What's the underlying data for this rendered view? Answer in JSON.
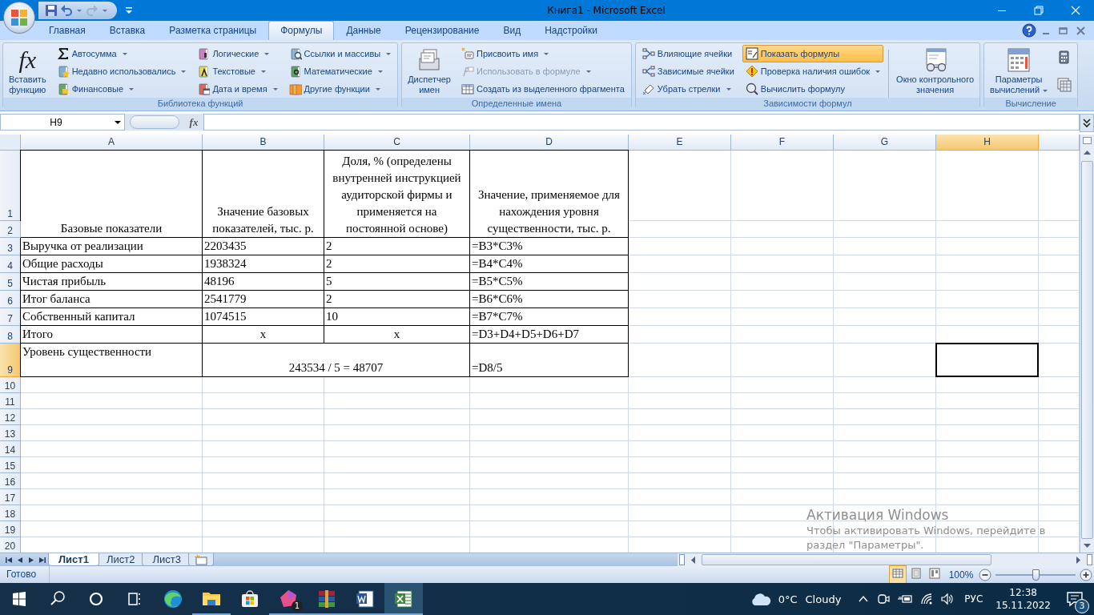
{
  "title_bar": {
    "title": "Книга1 - Microsoft Excel"
  },
  "ribbon": {
    "tabs": [
      {
        "label": "Главная",
        "selected": false
      },
      {
        "label": "Вставка",
        "selected": false
      },
      {
        "label": "Разметка страницы",
        "selected": false
      },
      {
        "label": "Формулы",
        "selected": true
      },
      {
        "label": "Данные",
        "selected": false
      },
      {
        "label": "Рецензирование",
        "selected": false
      },
      {
        "label": "Вид",
        "selected": false
      },
      {
        "label": "Надстройки",
        "selected": false
      }
    ],
    "groups": [
      {
        "label": "Библиотека функций",
        "controls": [
          {
            "kind": "large",
            "label": "Вставить\nфункцию",
            "glyph": "fx",
            "dropdown": false
          },
          {
            "kind": "column",
            "items": [
              {
                "label": "Автосумма",
                "dropdown": true,
                "disabled": false,
                "on": false
              },
              {
                "label": "Недавно использовались",
                "dropdown": true,
                "disabled": false,
                "on": false
              },
              {
                "label": "Финансовые",
                "dropdown": true,
                "disabled": false,
                "on": false
              }
            ]
          },
          {
            "kind": "column",
            "items": [
              {
                "label": "Логические",
                "dropdown": true,
                "disabled": false,
                "on": false
              },
              {
                "label": "Текстовые",
                "dropdown": true,
                "disabled": false,
                "on": false
              },
              {
                "label": "Дата и время",
                "dropdown": true,
                "disabled": false,
                "on": false
              }
            ]
          },
          {
            "kind": "column",
            "items": [
              {
                "label": "Ссылки и массивы",
                "dropdown": true,
                "disabled": false,
                "on": false
              },
              {
                "label": "Математические",
                "dropdown": true,
                "disabled": false,
                "on": false
              },
              {
                "label": "Другие функции",
                "dropdown": true,
                "disabled": false,
                "on": false
              }
            ]
          }
        ]
      },
      {
        "label": "Определенные имена",
        "controls": [
          {
            "kind": "large",
            "label": "Диспетчер\nимен",
            "dropdown": false
          },
          {
            "kind": "column",
            "items": [
              {
                "label": "Присвоить имя",
                "dropdown": true,
                "disabled": false,
                "on": false
              },
              {
                "label": "Использовать в формуле",
                "dropdown": true,
                "disabled": true,
                "on": false
              },
              {
                "label": "Создать из выделенного фрагмента",
                "dropdown": false,
                "disabled": false,
                "on": false
              }
            ]
          }
        ]
      },
      {
        "label": "Зависимости формул",
        "controls": [
          {
            "kind": "column",
            "items": [
              {
                "label": "Влияющие ячейки",
                "dropdown": false,
                "disabled": false,
                "on": false
              },
              {
                "label": "Зависимые ячейки",
                "dropdown": false,
                "disabled": false,
                "on": false
              },
              {
                "label": "Убрать стрелки",
                "dropdown": true,
                "disabled": false,
                "on": false
              }
            ]
          },
          {
            "kind": "column",
            "items": [
              {
                "label": "Показать формулы",
                "dropdown": false,
                "disabled": false,
                "on": true
              },
              {
                "label": "Проверка наличия ошибок",
                "dropdown": true,
                "disabled": false,
                "on": false
              },
              {
                "label": "Вычислить формулу",
                "dropdown": false,
                "disabled": false,
                "on": false
              }
            ]
          },
          {
            "kind": "separator"
          },
          {
            "kind": "large",
            "label": "Окно контрольного\nзначения",
            "dropdown": false
          }
        ]
      },
      {
        "label": "Вычисление",
        "controls": [
          {
            "kind": "large",
            "label": "Параметры\nвычислений",
            "dropdown": true
          },
          {
            "kind": "icons",
            "buttons": [
              {
                "on": false
              },
              {
                "on": false
              }
            ]
          }
        ]
      }
    ]
  },
  "formula_bar": {
    "name_box": "H9",
    "fx": "fx"
  },
  "sheet": {
    "columns": [
      {
        "label": "A",
        "selected": false
      },
      {
        "label": "B",
        "selected": false
      },
      {
        "label": "C",
        "selected": false
      },
      {
        "label": "D",
        "selected": false
      },
      {
        "label": "E",
        "selected": false
      },
      {
        "label": "F",
        "selected": false
      },
      {
        "label": "G",
        "selected": false
      },
      {
        "label": "H",
        "selected": true
      }
    ],
    "rows": [
      {
        "number": "1",
        "selected": false,
        "kind": "header",
        "cells": [
          "Базовые показатели",
          "Значение базовых показателей, тыс. р.",
          "Доля, % (определены внутренней инструкцией аудиторской фирмы и применяется на постоянной основе)",
          "Значение, применяемое для нахождения уровня существенности, тыс. р."
        ]
      },
      {
        "number": "2",
        "selected": false
      },
      {
        "number": "3",
        "selected": false,
        "kind": "data",
        "cells": [
          "Выручка от реализации",
          "2203435",
          "2",
          "=B3*C3%"
        ]
      },
      {
        "number": "4",
        "selected": false,
        "kind": "data",
        "cells": [
          "Общие расходы",
          "1938324",
          "2",
          "=B4*C4%"
        ]
      },
      {
        "number": "5",
        "selected": false,
        "kind": "data",
        "cells": [
          "Чистая прибыль",
          "48196",
          "5",
          "=B5*C5%"
        ]
      },
      {
        "number": "6",
        "selected": false,
        "kind": "data",
        "cells": [
          "Итог баланса",
          "2541779",
          "2",
          "=B6*C6%"
        ]
      },
      {
        "number": "7",
        "selected": false,
        "kind": "data",
        "cells": [
          "Собственный капитал",
          "1074515",
          "10",
          "=B7*C7%"
        ]
      },
      {
        "number": "8",
        "selected": false,
        "kind": "total",
        "cells": [
          "Итого",
          "x",
          "x",
          "=D3+D4+D5+D6+D7"
        ]
      },
      {
        "number": "9",
        "selected": true,
        "kind": "summary",
        "cells": [
          "Уровень существенности",
          "243534 / 5 = 48707",
          "=D8/5"
        ]
      },
      {
        "number": "10",
        "selected": false
      },
      {
        "number": "11",
        "selected": false
      },
      {
        "number": "12",
        "selected": false
      },
      {
        "number": "13",
        "selected": false
      },
      {
        "number": "14",
        "selected": false
      },
      {
        "number": "15",
        "selected": false
      },
      {
        "number": "16",
        "selected": false
      },
      {
        "number": "17",
        "selected": false
      },
      {
        "number": "18",
        "selected": false
      },
      {
        "number": "19",
        "selected": false
      },
      {
        "number": "20",
        "selected": false
      }
    ]
  },
  "sheet_tabs": [
    {
      "label": "Лист1",
      "selected": true
    },
    {
      "label": "Лист2",
      "selected": false
    },
    {
      "label": "Лист3",
      "selected": false
    }
  ],
  "status_bar": {
    "status": "Готово",
    "views": [
      {
        "selected": true
      },
      {
        "selected": false
      },
      {
        "selected": false
      }
    ],
    "zoom": {
      "label": "100%",
      "level": 0.5
    }
  },
  "activation_notice": {
    "title": "Активация Windows",
    "lines": [
      "Чтобы активировать Windows, перейдите в",
      "раздел \"Параметры\"."
    ]
  },
  "taskbar": {
    "apps": [
      {
        "running": false,
        "selected": false
      },
      {
        "running": true,
        "selected": false
      },
      {
        "running": false,
        "selected": false
      },
      {
        "running": true,
        "selected": false,
        "badge": "1"
      },
      {
        "running": true,
        "selected": false
      },
      {
        "running": true,
        "selected": false
      },
      {
        "running": true,
        "selected": true
      }
    ],
    "temperature": "0°C",
    "condition": "Cloudy",
    "language": "РУС",
    "time": "12:38",
    "date": "15.11.2022",
    "notifications": "3"
  }
}
